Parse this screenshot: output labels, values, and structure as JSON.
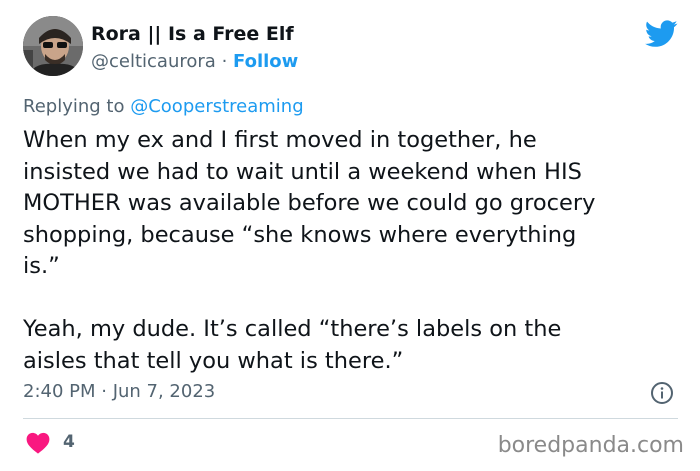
{
  "author": {
    "display_name": "Rora || Is a Free Elf",
    "handle": "@celticaurora",
    "separator": "·",
    "follow_label": "Follow",
    "avatar_icon": "user-avatar-icon"
  },
  "reply": {
    "prefix": "Replying to",
    "mention": "@Cooperstreaming"
  },
  "tweet": {
    "lines_a": [
      "When my ex and I first moved in together, he",
      "insisted we had to wait until a weekend when HIS",
      "MOTHER was available before we could go grocery",
      "shopping, because “she knows where everything",
      "is.”"
    ],
    "lines_b": [
      "Yeah, my dude. It’s called “there’s labels on the",
      "aisles that tell you what is there.”"
    ]
  },
  "meta": {
    "timestamp": "2:40 PM · Jun 7, 2023"
  },
  "stats": {
    "likes": "4"
  },
  "watermark": "boredpanda.com",
  "colors": {
    "accent": "#1d9bf0",
    "heart": "#f91880",
    "muted": "#536471"
  }
}
